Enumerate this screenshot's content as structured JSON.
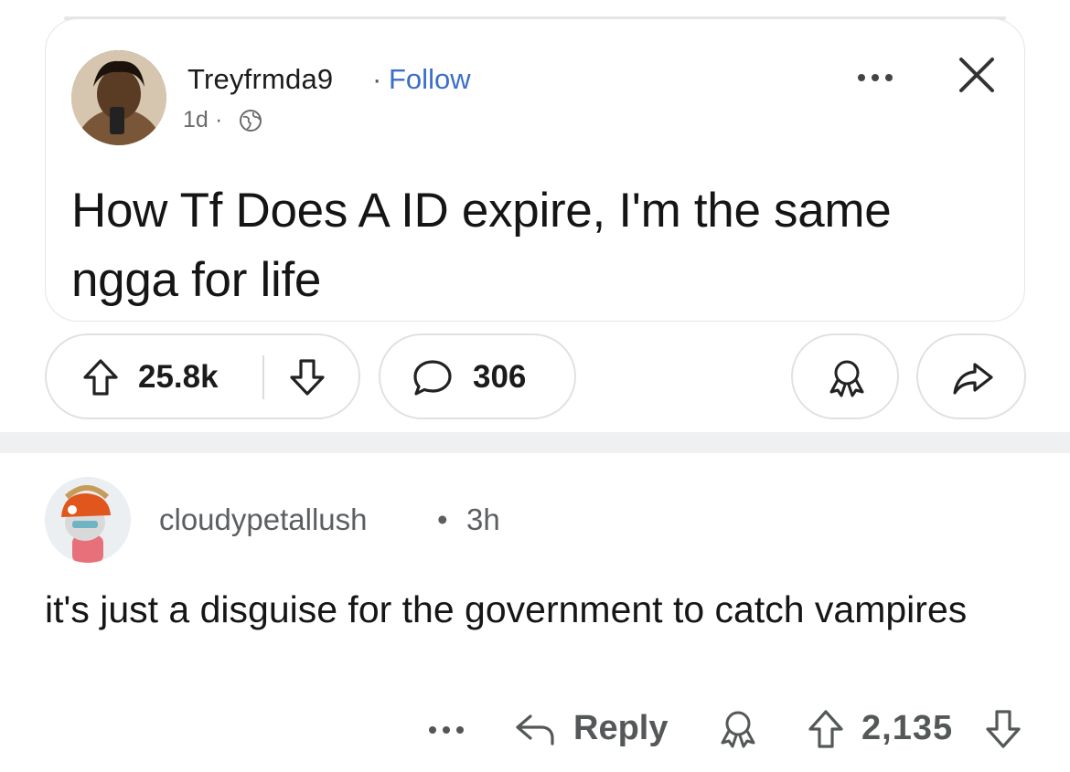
{
  "post": {
    "username": "Treyfrmda9",
    "separator": "·",
    "follow_label": "Follow",
    "age": "1d",
    "meta_separator": "·",
    "title": "How Tf Does A ID expire, I'm the same ngga for life",
    "upvotes": "25.8k",
    "comments": "306"
  },
  "comment": {
    "username": "cloudypetallush",
    "separator": "•",
    "age": "3h",
    "body": "it's just a disguise for the government to catch vampires",
    "reply_label": "Reply",
    "score": "2,135"
  },
  "colors": {
    "follow": "#3a6ec9",
    "separator_band": "#eef0f2",
    "pill_border": "#dfe1e4",
    "muted_text": "#5c5f62"
  },
  "icons": {
    "globe": "globe-icon",
    "more": "more-horizontal-icon",
    "close": "close-icon",
    "upvote": "upvote-arrow-icon",
    "downvote": "downvote-arrow-icon",
    "comment": "speech-bubble-icon",
    "award": "award-icon",
    "share": "share-arrow-icon",
    "reply": "reply-arrow-icon"
  }
}
